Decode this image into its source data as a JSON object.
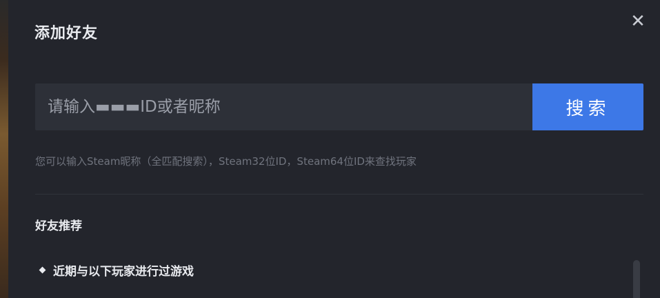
{
  "dialog": {
    "title": "添加好友",
    "close_symbol": "✕"
  },
  "search": {
    "placeholder": "请输入▬▬▬ID或者昵称",
    "value": "",
    "button_label": "搜索",
    "hint": "您可以输入Steam昵称（全匹配搜索），Steam32位ID，Steam64位ID来查找玩家"
  },
  "recommend": {
    "section_title": "好友推荐",
    "items": [
      {
        "label": "近期与以下玩家进行过游戏",
        "icon": "diamond-bullet-icon"
      }
    ]
  },
  "colors": {
    "background": "#23252c",
    "input_bg": "#2d3038",
    "accent": "#3d78e7",
    "text": "#e9ebef",
    "muted": "#70747e"
  }
}
